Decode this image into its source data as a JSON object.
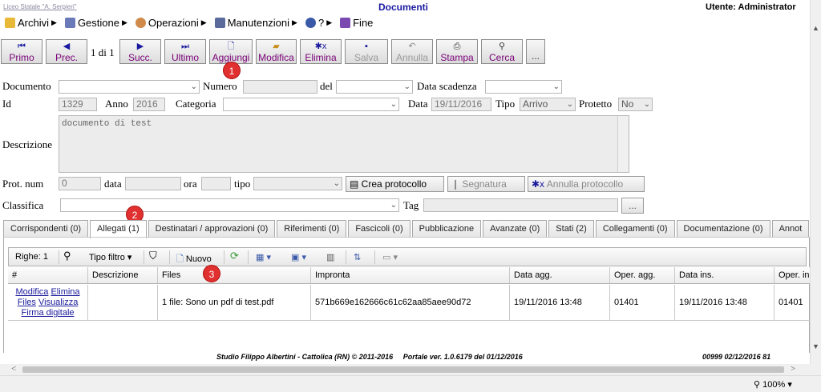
{
  "header": {
    "school": "Liceo Statale \"A. Serpieri\"",
    "title": "Documenti",
    "user": "Utente: Administrator"
  },
  "menu": [
    {
      "label": "Archivi",
      "icon": "folder-icon"
    },
    {
      "label": "Gestione",
      "icon": "list-icon"
    },
    {
      "label": "Operazioni",
      "icon": "gears-icon"
    },
    {
      "label": "Manutenzioni",
      "icon": "maintenance-icon"
    },
    {
      "label": "?",
      "icon": "help-icon"
    },
    {
      "label": "Fine",
      "icon": "exit-icon"
    }
  ],
  "toolbar": {
    "first": "Primo",
    "prev": "Prec.",
    "pager": "1 di 1",
    "next": "Succ.",
    "last": "Ultimo",
    "add": "Aggiungi",
    "edit": "Modifica",
    "delete": "Elimina",
    "save": "Salva",
    "cancel": "Annulla",
    "print": "Stampa",
    "search": "Cerca",
    "more": "..."
  },
  "badges": {
    "b1": "1",
    "b2": "2",
    "b3": "3"
  },
  "form": {
    "documento_label": "Documento",
    "numero_label": "Numero",
    "del_label": "del",
    "data_scadenza_label": "Data scadenza",
    "id_label": "Id",
    "id_value": "1329",
    "anno_label": "Anno",
    "anno_value": "2016",
    "categoria_label": "Categoria",
    "data_label": "Data",
    "data_value": "19/11/2016",
    "tipo_label": "Tipo",
    "tipo_value": "Arrivo",
    "protetto_label": "Protetto",
    "protetto_value": "No",
    "descrizione_label": "Descrizione",
    "descrizione_value": "documento di test",
    "prot_num_label": "Prot. num",
    "prot_num_value": "0",
    "prot_data_label": "data",
    "prot_ora_label": "ora",
    "prot_tipo_label": "tipo",
    "crea_protocollo": "Crea protocollo",
    "segnatura": "Segnatura",
    "annulla_protocollo": "Annulla protocollo",
    "classifica_label": "Classifica",
    "tag_label": "Tag",
    "tag_more": "..."
  },
  "tabs": [
    "Corrispondenti (0)",
    "Allegati (1)",
    "Destinatari / approvazioni (0)",
    "Riferimenti (0)",
    "Fascicoli (0)",
    "Pubblicazione",
    "Avanzate (0)",
    "Stati (2)",
    "Collegamenti (0)",
    "Documentazione (0)",
    "Annot"
  ],
  "grid": {
    "rows_label": "Righe: 1",
    "filter_label": "Tipo filtro",
    "new_label": "Nuovo",
    "columns": [
      "#",
      "Descrizione",
      "Files",
      "Impronta",
      "Data agg.",
      "Oper. agg.",
      "Data ins.",
      "Oper. ins."
    ],
    "row": {
      "modifica": "Modifica",
      "elimina": "Elimina",
      "files": "Files",
      "visualizza": "Visualizza",
      "firma": "Firma digitale",
      "descrizione": "",
      "files_value": "1 file: Sono un pdf di test.pdf",
      "impronta": "571b669e162666c61c62aa85aee90d72",
      "data_agg": "19/11/2016 13:48",
      "oper_agg": "01401",
      "data_ins": "19/11/2016 13:48",
      "oper_ins": "01401"
    }
  },
  "footer": {
    "studio": "Studio Filippo Albertini - Cattolica (RN) © 2011-2016",
    "portale": "Portale ver. 1.0.6179 del 01/12/2016",
    "code": "00999  02/12/2016  81"
  },
  "status": {
    "zoom": "100%"
  }
}
